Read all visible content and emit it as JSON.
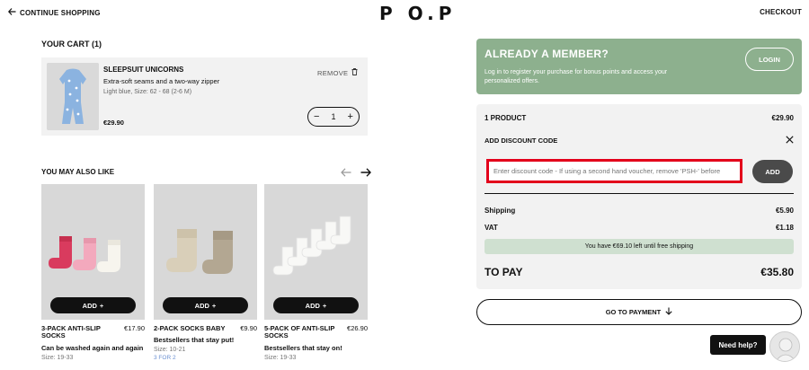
{
  "header": {
    "continue_label": "CONTINUE SHOPPING",
    "logo": "P O.P",
    "checkout_label": "CHECKOUT"
  },
  "cart": {
    "title": "YOUR CART (1)",
    "item": {
      "name": "SLEEPSUIT UNICORNS",
      "description": "Extra-soft seams and a two-way zipper",
      "variant": "Light blue, Size: 62 - 68 (2-6 M)",
      "price": "€29.90",
      "remove_label": "REMOVE",
      "quantity": "1"
    }
  },
  "recommendations": {
    "title": "YOU MAY ALSO LIKE",
    "add_label": "ADD",
    "items": [
      {
        "name": "3-PACK ANTI-SLIP SOCKS",
        "price": "€17.90",
        "tagline": "Can be washed again and again",
        "size": "Size: 19-33",
        "promo": ""
      },
      {
        "name": "2-PACK SOCKS BABY",
        "price": "€9.90",
        "tagline": "Bestsellers that stay put!",
        "size": "Size: 10-21",
        "promo": "3 FOR 2"
      },
      {
        "name": "5-PACK OF ANTI-SLIP SOCKS",
        "price": "€26.90",
        "tagline": "Bestsellers that stay on!",
        "size": "Size: 19-33",
        "promo": ""
      }
    ]
  },
  "member": {
    "title": "ALREADY A MEMBER?",
    "text": "Log in to register your purchase for bonus points and access your personalized offers.",
    "login_label": "LOGIN"
  },
  "summary": {
    "products_label": "1 PRODUCT",
    "products_value": "€29.90",
    "discount_label": "ADD DISCOUNT CODE",
    "discount_placeholder": "Enter discount code - If using a second hand voucher, remove 'PSH-' before",
    "add_label": "ADD",
    "shipping_label": "Shipping",
    "shipping_value": "€5.90",
    "vat_label": "VAT",
    "vat_value": "€1.18",
    "free_shipping_note": "You have €69.10 left until free shipping",
    "to_pay_label": "TO PAY",
    "to_pay_value": "€35.80"
  },
  "payment": {
    "label": "GO TO PAYMENT"
  },
  "help": {
    "label": "Need help?"
  },
  "colors": {
    "member_bg": "#8db08e",
    "highlight": "#e3001b",
    "shipping_note_bg": "#cfe0d0"
  }
}
